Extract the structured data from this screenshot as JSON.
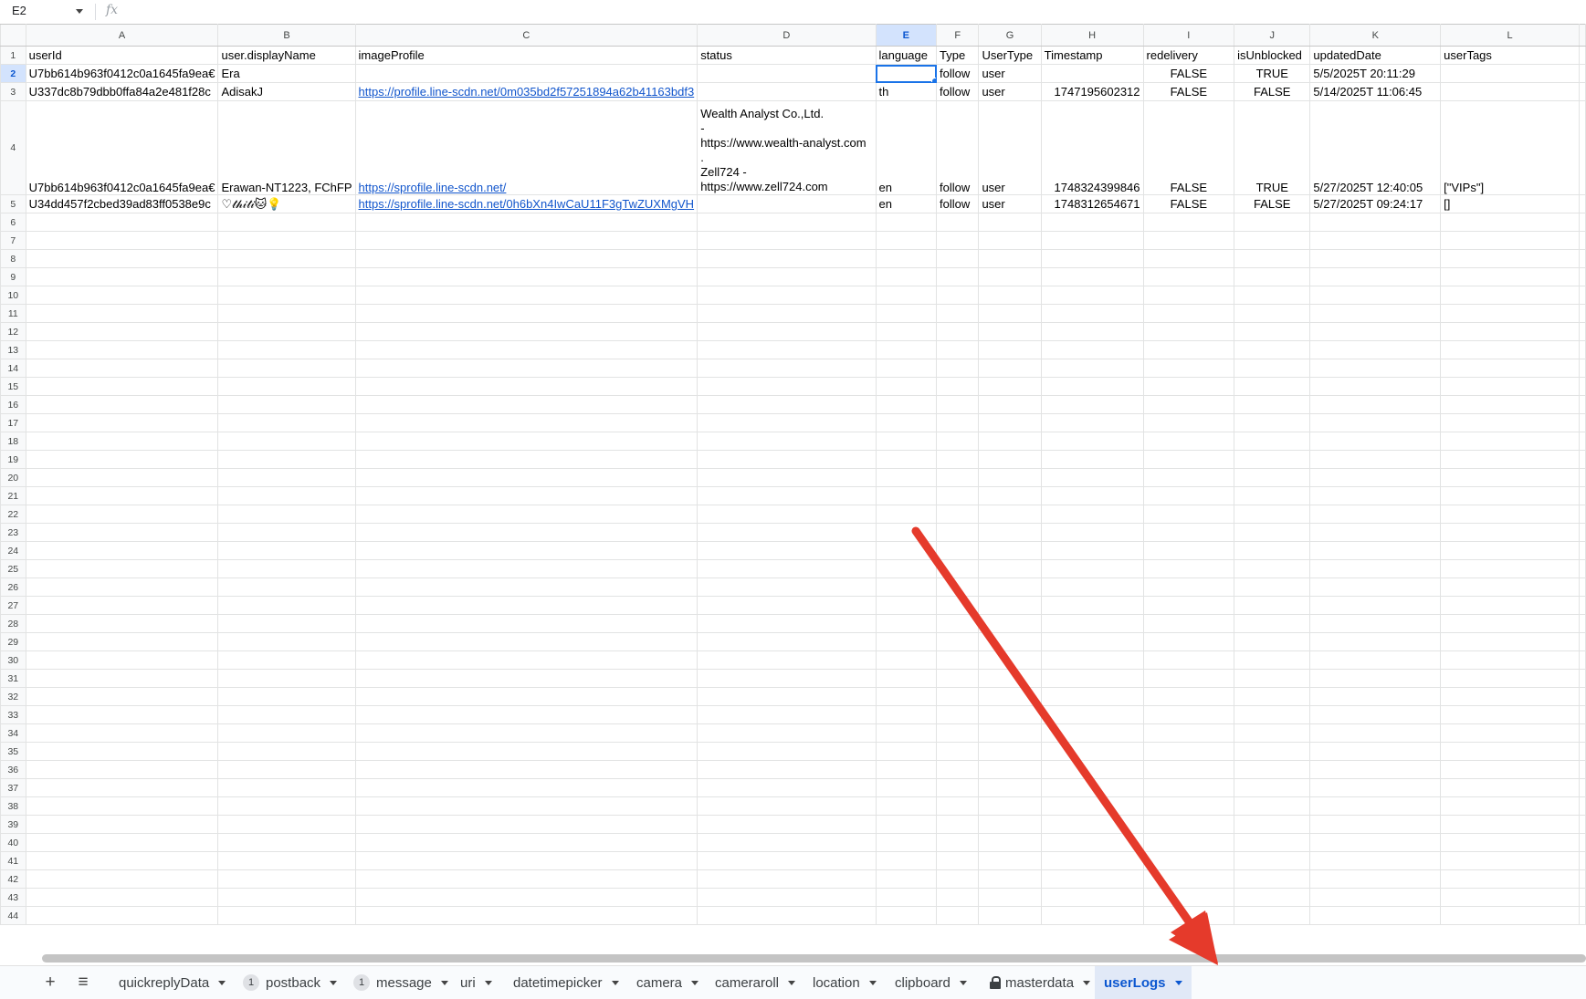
{
  "formula_bar": {
    "cell_ref": "E2",
    "fx_label": "fx",
    "formula_value": ""
  },
  "columns": [
    "A",
    "B",
    "C",
    "D",
    "E",
    "F",
    "G",
    "H",
    "I",
    "J",
    "K",
    "L"
  ],
  "selected_column": "E",
  "header_row": [
    "userId",
    "user.displayName",
    "imageProfile",
    "status",
    "language",
    "Type",
    "UserType",
    "Timestamp",
    "redelivery",
    "isUnblocked",
    "updatedDate",
    "userTags"
  ],
  "rows": [
    {
      "num": "2",
      "cells": [
        "U7bb614b963f0412c0a1645fa9ea€",
        "Era",
        "",
        "",
        "",
        "follow",
        "user",
        "",
        "FALSE",
        "TRUE",
        "5/5/2025T 20:11:29",
        ""
      ]
    },
    {
      "num": "3",
      "cells": [
        "U337dc8b79dbb0ffa84a2e481f28c",
        "AdisakJ",
        "https://profile.line-scdn.net/0m035bd2f57251894a62b41163bdf3",
        "",
        "th",
        "follow",
        "user",
        "1747195602312",
        "FALSE",
        "FALSE",
        "5/14/2025T 11:06:45",
        ""
      ]
    },
    {
      "num": "4",
      "cells": [
        "U7bb614b963f0412c0a1645fa9ea€",
        "Erawan-NT1223, FChFP",
        "https://sprofile.line-scdn.net/",
        "Wealth Analyst Co.,Ltd.\n-\nhttps://www.wealth-analyst.com\n.\nZell724 -\nhttps://www.zell724.com",
        "en",
        "follow",
        "user",
        "1748324399846",
        "FALSE",
        "TRUE",
        "5/27/2025T 12:40:05",
        "[\"VIPs\"]"
      ]
    },
    {
      "num": "5",
      "cells": [
        "U34dd457f2cbed39ad83ff0538e9c",
        "♡𝓉𝒽𝒾𝓉𝒾🐱💡",
        "https://sprofile.line-scdn.net/0h6bXn4IwCaU11F3gTwZUXMgVH",
        "",
        "en",
        "follow",
        "user",
        "1748312654671",
        "FALSE",
        "FALSE",
        "5/27/2025T 09:24:17",
        "[]"
      ]
    }
  ],
  "empty_row_numbers": [
    "6",
    "7",
    "8",
    "9",
    "10",
    "11",
    "12",
    "13",
    "14",
    "15",
    "16",
    "17",
    "18",
    "19",
    "20",
    "21",
    "22",
    "23",
    "24",
    "25",
    "26",
    "27",
    "28",
    "29",
    "30",
    "31",
    "32",
    "33",
    "34",
    "35",
    "36",
    "37",
    "38",
    "39",
    "40",
    "41",
    "42",
    "43",
    "44"
  ],
  "sheet_tabs": [
    {
      "label": "quickreplyData",
      "badge": ""
    },
    {
      "label": "postback",
      "badge": "1"
    },
    {
      "label": "message",
      "badge": "1"
    },
    {
      "label": "uri",
      "badge": ""
    },
    {
      "label": "datetimepicker",
      "badge": ""
    },
    {
      "label": "camera",
      "badge": ""
    },
    {
      "label": "cameraroll",
      "badge": ""
    },
    {
      "label": "location",
      "badge": ""
    },
    {
      "label": "clipboard",
      "badge": ""
    },
    {
      "label": "masterdata",
      "badge": "",
      "locked": true
    },
    {
      "label": "userLogs",
      "badge": "",
      "active": true
    }
  ],
  "tab_icons": {
    "add": "plus-icon",
    "all_sheets": "menu-icon"
  },
  "colors": {
    "accent": "#1a73e8",
    "selected_header": "#d3e3fd",
    "link": "#1155cc",
    "arrow": "#e53a2b",
    "active_tab_bg": "#e1e9f7"
  }
}
